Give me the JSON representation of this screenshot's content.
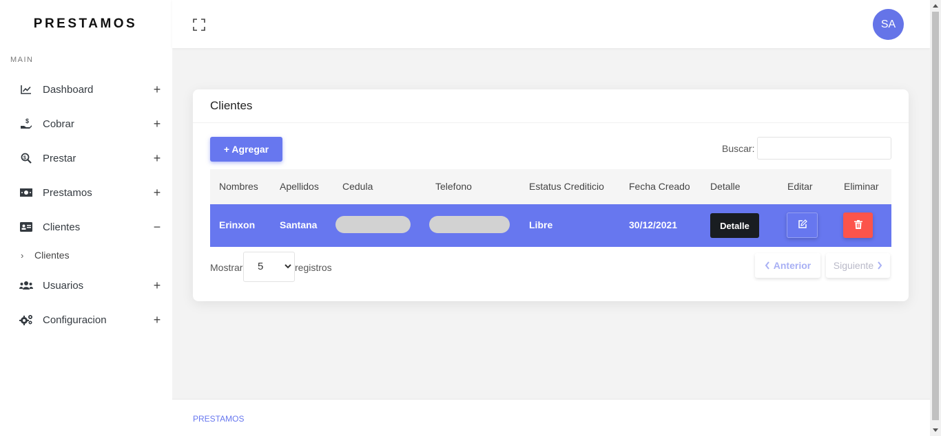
{
  "brand": "PRESTAMOS",
  "sidebar": {
    "section_label": "MAIN",
    "items": [
      {
        "label": "Dashboard",
        "sign": "+"
      },
      {
        "label": "Cobrar",
        "sign": "+"
      },
      {
        "label": "Prestar",
        "sign": "+"
      },
      {
        "label": "Prestamos",
        "sign": "+"
      },
      {
        "label": "Clientes",
        "sign": "−"
      },
      {
        "label": "Usuarios",
        "sign": "+"
      },
      {
        "label": "Configuracion",
        "sign": "+"
      }
    ],
    "sub_items": [
      {
        "chevron": "›",
        "label": "Clientes"
      }
    ]
  },
  "topbar": {
    "avatar_initials": "SA"
  },
  "card": {
    "title": "Clientes",
    "add_button": "+ Agregar",
    "search_label": "Buscar:",
    "search_value": "",
    "columns": [
      "Nombres",
      "Apellidos",
      "Cedula",
      "Telefono",
      "Estatus Crediticio",
      "Fecha Creado",
      "Detalle",
      "Editar",
      "Eliminar"
    ],
    "rows": [
      {
        "nombres": "Erinxon",
        "apellidos": "Santana",
        "cedula": "",
        "telefono": "",
        "estatus": "Libre",
        "fecha": "30/12/2021",
        "detalle_button": "Detalle"
      }
    ],
    "show_label": "Mostrar",
    "page_size": "5",
    "registros_label": "registros",
    "prev_button": "Anterior",
    "next_button": "Siguiente"
  },
  "footer": {
    "text": "PRESTAMOS"
  },
  "colors": {
    "accent": "#6777ef",
    "danger": "#fc544b",
    "dark": "#191d21"
  }
}
